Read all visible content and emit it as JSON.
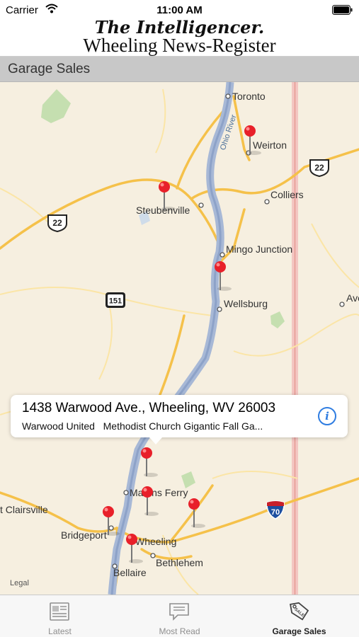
{
  "status_bar": {
    "carrier": "Carrier",
    "time": "11:00 AM"
  },
  "masthead": {
    "line1": "The Intelligencer.",
    "line2": "Wheeling News-Register"
  },
  "section": {
    "title": "Garage Sales"
  },
  "map": {
    "labels": {
      "toronto": "Toronto",
      "weirton": "Weirton",
      "colliers": "Colliers",
      "steubenville": "Steubenville",
      "mingo_junction": "Mingo Junction",
      "wellsburg": "Wellsburg",
      "ave": "Ave",
      "martins_ferry": "Martins Ferry",
      "st_clairsville": "t Clairsville",
      "bridgeport": "Bridgeport",
      "wheeling": "Wheeling",
      "bethlehem": "Bethlehem",
      "bellaire": "Bellaire",
      "ohio_river": "Ohio River"
    },
    "shields": {
      "us22_east": "22",
      "us22_west": "22",
      "wv151": "151",
      "i70": "70"
    },
    "legal": "Legal"
  },
  "callout": {
    "address": "1438 Warwood Ave., Wheeling, WV 26003",
    "description": "Warwood United   Methodist Church Gigantic Fall Ga..."
  },
  "tabs": [
    {
      "label": "Latest",
      "icon": "newspaper-icon",
      "active": false
    },
    {
      "label": "Most Read",
      "icon": "chat-bubble-icon",
      "active": false
    },
    {
      "label": "Garage Sales",
      "icon": "sale-tag-icon",
      "active": true
    }
  ],
  "colors": {
    "accent": "#2f7de1",
    "pin": "#e8202a",
    "river": "#a7b8d6",
    "road": "#f5c14a"
  }
}
